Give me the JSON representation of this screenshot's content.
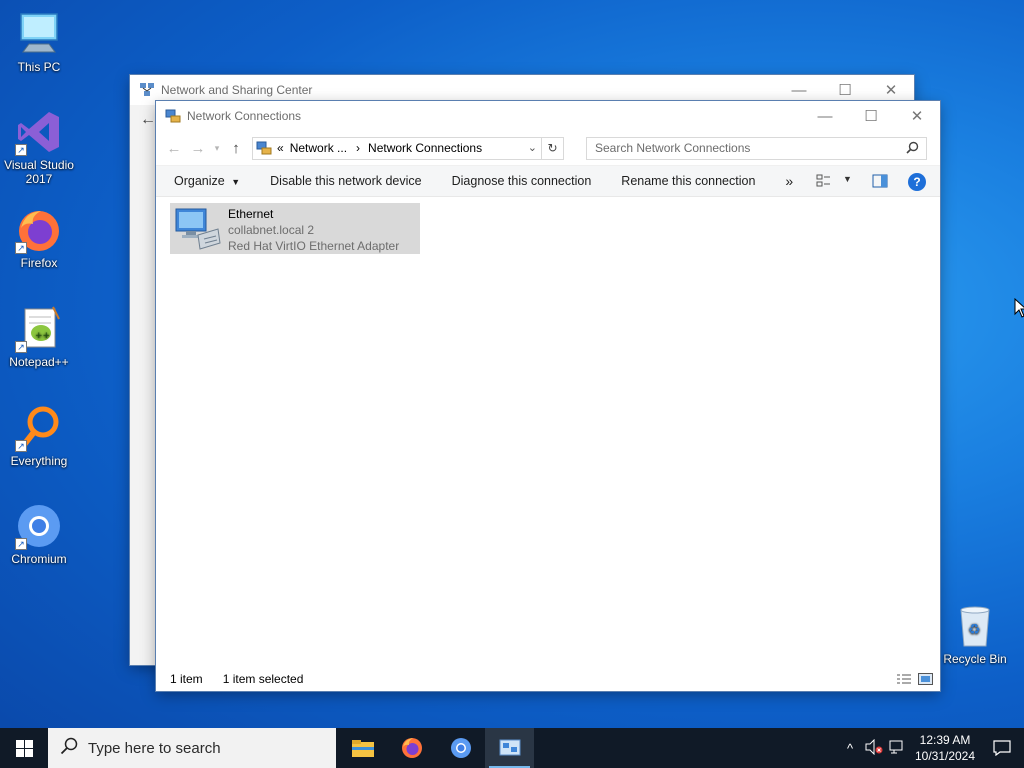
{
  "desktop": {
    "icons": [
      {
        "label": "This PC"
      },
      {
        "label": "Visual Studio 2017"
      },
      {
        "label": "Firefox"
      },
      {
        "label": "Notepad++"
      },
      {
        "label": "Everything"
      },
      {
        "label": "Chromium"
      },
      {
        "label": "Recycle Bin"
      }
    ]
  },
  "back_window": {
    "title": "Network and Sharing Center"
  },
  "window": {
    "title": "Network Connections",
    "breadcrumb": {
      "overflow": "«",
      "parent": "Network ...",
      "separator": "›",
      "current": "Network Connections"
    },
    "search_placeholder": "Search Network Connections",
    "commands": {
      "organize": "Organize",
      "disable": "Disable this network device",
      "diagnose": "Diagnose this connection",
      "rename": "Rename this connection",
      "more": "»"
    },
    "items": [
      {
        "name": "Ethernet",
        "network": "collabnet.local 2",
        "adapter": "Red Hat VirtIO Ethernet Adapter"
      }
    ],
    "status": {
      "count": "1 item",
      "selected": "1 item selected"
    }
  },
  "taskbar": {
    "search_placeholder": "Type here to search",
    "clock_time": "12:39 AM",
    "clock_date": "10/31/2024"
  },
  "colors": {
    "accent": "#0a64c8",
    "selection": "#d9d9d9",
    "taskbar": "#101a27",
    "help_icon": "#1e6fd9"
  }
}
